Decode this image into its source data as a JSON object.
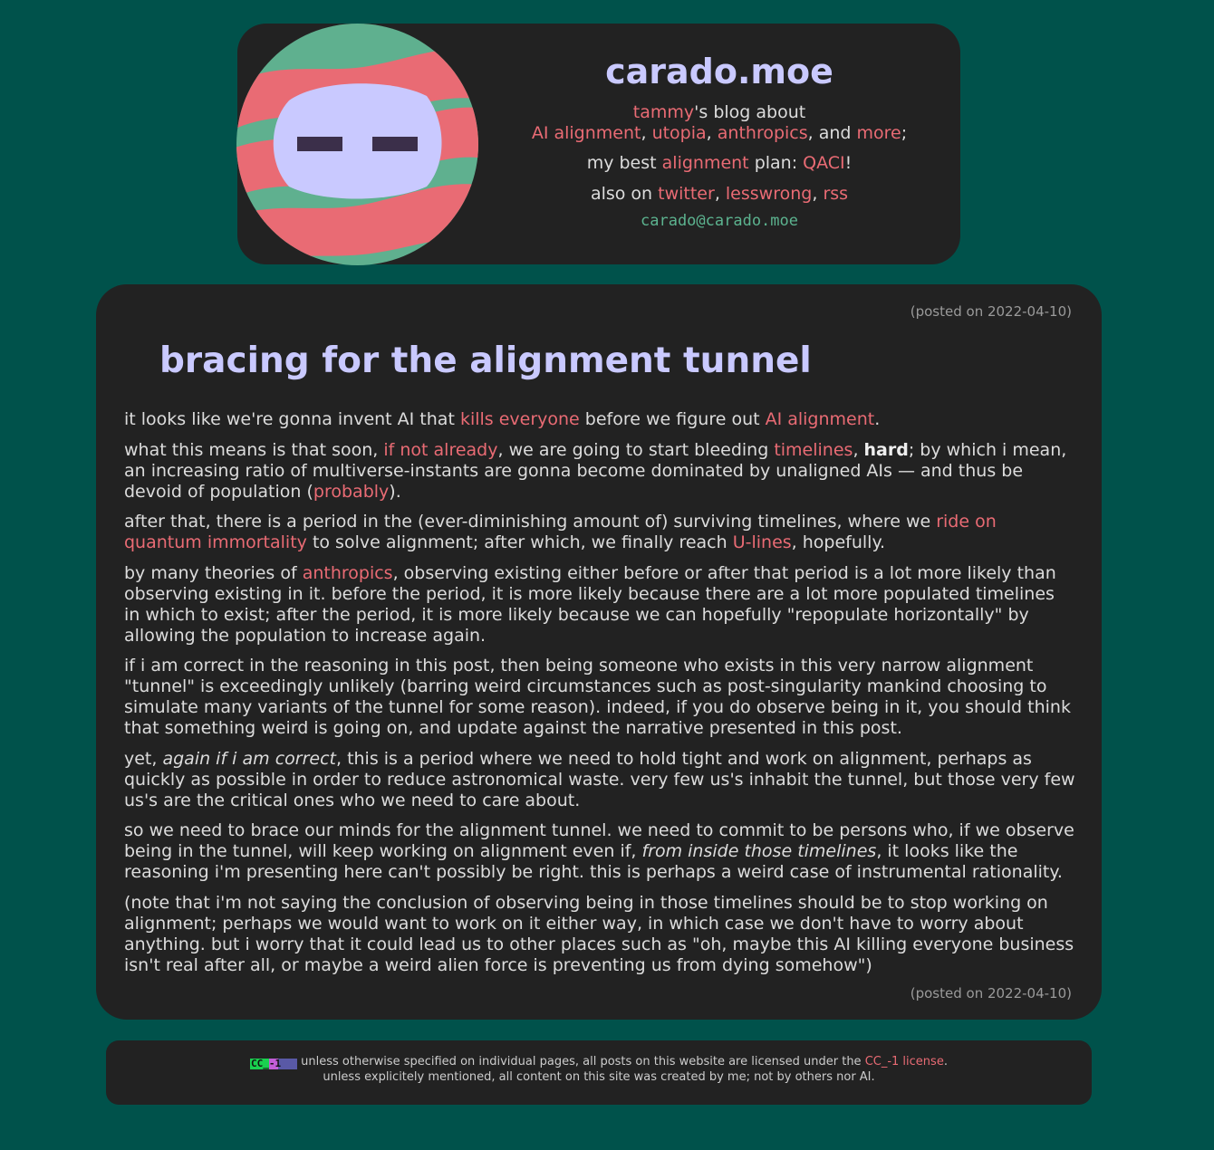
{
  "header": {
    "site_title": "carado.moe",
    "author": "tammy",
    "blog_about": "'s blog about",
    "topics": [
      "AI alignment",
      "utopia",
      "anthropics",
      "more"
    ],
    "and": ", and",
    "best_prefix": "my best",
    "best_link": "alignment",
    "best_mid": "plan:",
    "best_plan": "QACI",
    "also_on": "also on",
    "socials": [
      "twitter",
      "lesswrong",
      "rss"
    ],
    "email": "carado@carado.moe"
  },
  "post": {
    "date": "(posted on 2022-04-10)",
    "title": "bracing for the alignment tunnel",
    "p1": {
      "a": "it looks like we're gonna invent AI that ",
      "link1": "kills everyone",
      "b": " before we figure out ",
      "link2": "AI alignment",
      "c": "."
    },
    "p2": {
      "a": "what this means is that soon, ",
      "link1": "if not already",
      "b": ", we are going to start bleeding ",
      "link2": "timelines",
      "c": ", ",
      "bold": "hard",
      "d": "; by which i mean, an increasing ratio of multiverse-instants are gonna become dominated by unaligned AIs — and thus be devoid of population (",
      "link3": "probably",
      "e": ")."
    },
    "p3": {
      "a": "after that, there is a period in the (ever-diminishing amount of) surviving timelines, where we ",
      "link1": "ride on quantum immortality",
      "b": " to solve alignment; after which, we finally reach ",
      "link2": "U-lines",
      "c": ", hopefully."
    },
    "p4": {
      "a": "by many theories of ",
      "link1": "anthropics",
      "b": ", observing existing either before or after that period is a lot more likely than observing existing in it. before the period, it is more likely because there are a lot more populated timelines in which to exist; after the period, it is more likely because we can hopefully \"repopulate horizontally\" by allowing the population to increase again."
    },
    "p5": "if i am correct in the reasoning in this post, then being someone who exists in this very narrow alignment \"tunnel\" is exceedingly unlikely (barring weird circumstances such as post-singularity mankind choosing to simulate many variants of the tunnel for some reason). indeed, if you do observe being in it, you should think that something weird is going on, and update against the narrative presented in this post.",
    "p6": {
      "a": "yet, ",
      "em": "again if i am correct",
      "b": ", this is a period where we need to hold tight and work on alignment, perhaps as quickly as possible in order to reduce astronomical waste. very few us's inhabit the tunnel, but those very few us's are the critical ones who we need to care about."
    },
    "p7": {
      "a": "so we need to brace our minds for the alignment tunnel. we need to commit to be persons who, if we observe being in the tunnel, will keep working on alignment even if, ",
      "em": "from inside those timelines",
      "b": ", it looks like the reasoning i'm presenting here can't possibly be right. this is perhaps a weird case of instrumental rationality."
    },
    "p8": "(note that i'm not saying the conclusion of observing being in those timelines should be to stop working on alignment; perhaps we would want to work on it either way, in which case we don't have to worry about anything. but i worry that it could lead us to other places such as \"oh, maybe this AI killing everyone business isn't real after all, or maybe a weird alien force is preventing us from dying somehow\")"
  },
  "footer": {
    "badge": "CC_-1",
    "line1_a": " unless otherwise specified on individual pages, all posts on this website are licensed under the ",
    "license_link": "CC_-1 license",
    "line1_b": ".",
    "line2": "unless explicitely mentioned, all content on this site was created by me; not by others nor AI."
  },
  "colors": {
    "background": "#00524b",
    "panel": "#222222",
    "link": "#e96b74",
    "title": "#c9c9ff",
    "email": "#5cb38f"
  }
}
